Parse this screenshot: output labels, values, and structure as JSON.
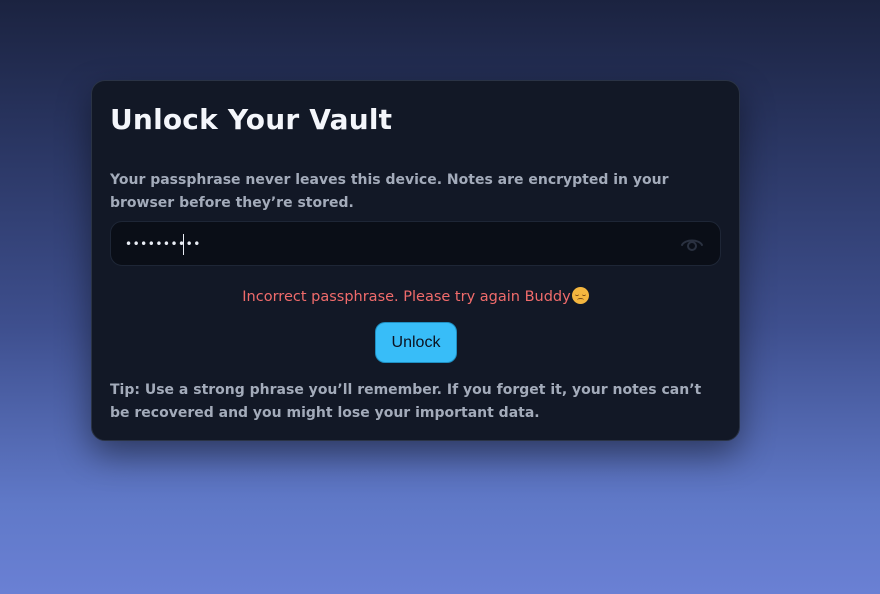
{
  "card": {
    "title": "Unlock Your Vault",
    "description": "Your passphrase never leaves this device. Notes are encrypted in your browser before they’re stored.",
    "passphrase_value": "••••••••••",
    "show_password_icon": "eye-icon",
    "error_message": "Incorrect passphrase. Please try again Buddy",
    "error_emoji": "disappointed-face-emoji",
    "unlock_label": "Unlock",
    "tip": "Tip: Use a strong phrase you’ll remember. If you forget it, your notes can’t be recovered and you might lose your important data."
  },
  "colors": {
    "card_background": "#121826",
    "button_accent": "#38bdf8",
    "error": "#f06b6b",
    "muted_text": "#a3abba"
  }
}
